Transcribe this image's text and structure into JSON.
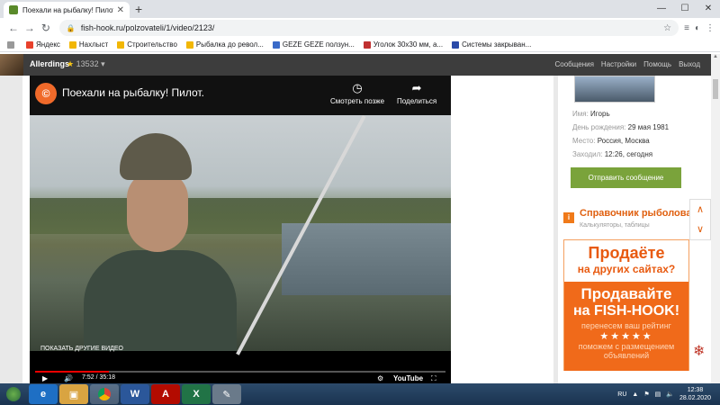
{
  "browser": {
    "tab_title": "Поехали на рыбалку! Пилот. (в",
    "url": "fish-hook.ru/polzovateli/1/video/2123/",
    "bookmarks": [
      {
        "label": "Яндекс",
        "color": "#e8412c"
      },
      {
        "label": "Нахлыст",
        "color": "#f2b705"
      },
      {
        "label": "Строительство",
        "color": "#f2b705"
      },
      {
        "label": "Рыбалка до револ...",
        "color": "#f2b705"
      },
      {
        "label": "GEZE GEZE ползун...",
        "color": "#3a6ac8"
      },
      {
        "label": "Уголок 30х30 мм, а...",
        "color": "#c03030"
      },
      {
        "label": "Системы закрыван...",
        "color": "#2a4aa8"
      }
    ]
  },
  "site": {
    "username": "Allerdings",
    "rating_star": "★",
    "rating": "13532",
    "nav": [
      "Сообщения",
      "Настройки",
      "Помощь",
      "Выход"
    ]
  },
  "video": {
    "logo": "©",
    "title": "Поехали на рыбалку! Пилот.",
    "watch_later": "Смотреть позже",
    "share": "Поделиться",
    "more_videos": "ПОКАЗАТЬ ДРУГИЕ ВИДЕО",
    "time": "7:52 / 35:18",
    "youtube": "YouTube",
    "progress": 0.18
  },
  "profile": {
    "name_k": "Имя:",
    "name_v": "Игорь",
    "bday_k": "День рождения:",
    "bday_v": "29 мая 1981",
    "place_k": "Место:",
    "place_v": "Россия, Москва",
    "seen_k": "Заходил:",
    "seen_v": "12:26, сегодня",
    "send_btn": "Отправить сообщение"
  },
  "reference": {
    "icon": "i",
    "title": "Справочник рыболова",
    "subtitle": "Калькуляторы, таблицы"
  },
  "promo": {
    "l1": "Продаёте",
    "l2": "на других сайтах?",
    "b1": "Продавайте",
    "b2": "на FISH-HOOK!",
    "b3": "перенесем ваш рейтинг",
    "stars": "★★★★★",
    "b4": "поможем с размещением объявлений"
  },
  "taskbar": {
    "lang": "RU",
    "time": "12:38",
    "date": "28.02.2020"
  }
}
